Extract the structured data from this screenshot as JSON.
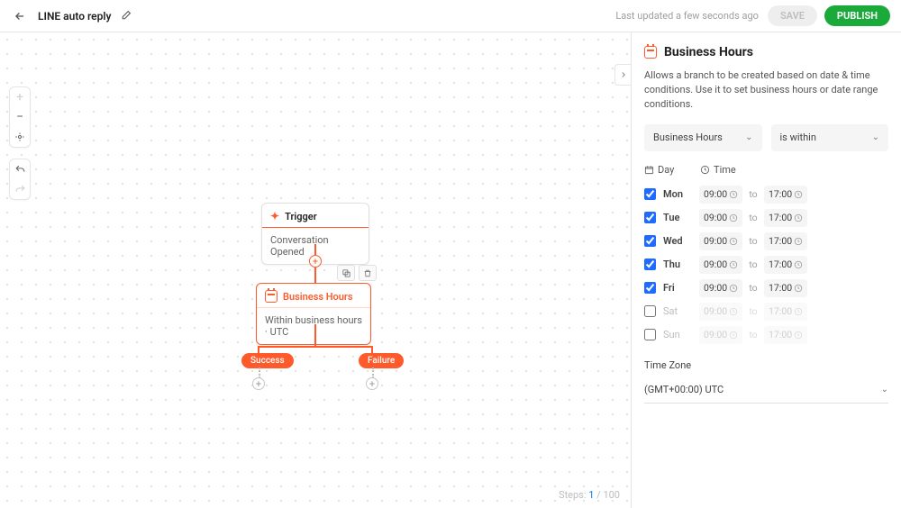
{
  "header": {
    "title": "LINE auto reply",
    "updated": "Last updated a few seconds ago",
    "save": "SAVE",
    "publish": "PUBLISH"
  },
  "canvas": {
    "trigger_title": "Trigger",
    "trigger_body": "Conversation Opened",
    "node_title": "Business Hours",
    "node_body": "Within business hours · UTC",
    "success": "Success",
    "failure": "Failure",
    "steps_label": "Steps:",
    "steps_current": "1",
    "steps_total": "/ 100"
  },
  "panel": {
    "title": "Business Hours",
    "desc": "Allows a branch to be created based on date & time conditions. Use it to set business hours or date range conditions.",
    "type_select": "Business Hours",
    "cond_select": "is within",
    "col_day": "Day",
    "col_time": "Time",
    "to": "to",
    "days": [
      {
        "label": "Mon",
        "checked": true,
        "start": "09:00",
        "end": "17:00"
      },
      {
        "label": "Tue",
        "checked": true,
        "start": "09:00",
        "end": "17:00"
      },
      {
        "label": "Wed",
        "checked": true,
        "start": "09:00",
        "end": "17:00"
      },
      {
        "label": "Thu",
        "checked": true,
        "start": "09:00",
        "end": "17:00"
      },
      {
        "label": "Fri",
        "checked": true,
        "start": "09:00",
        "end": "17:00"
      },
      {
        "label": "Sat",
        "checked": false,
        "start": "09:00",
        "end": "17:00"
      },
      {
        "label": "Sun",
        "checked": false,
        "start": "09:00",
        "end": "17:00"
      }
    ],
    "tz_label": "Time Zone",
    "tz_value": "(GMT+00:00) UTC"
  }
}
